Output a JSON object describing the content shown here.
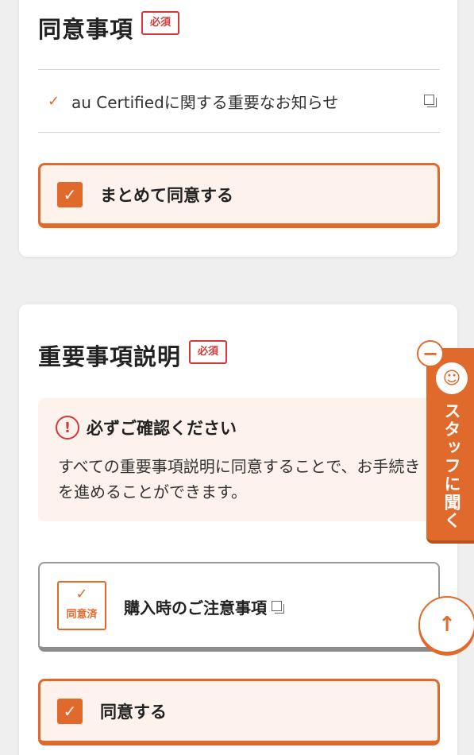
{
  "consent_section": {
    "title": "同意事項",
    "required_badge": "必須",
    "item_label": "au Certifiedに関する重要なお知らせ",
    "check_all_label": "まとめて同意する"
  },
  "important_section": {
    "title": "重要事項説明",
    "required_badge": "必須",
    "notice_title": "必ずご確認ください",
    "notice_body": "すべての重要事項説明に同意することで、お手続きを進めることができます。",
    "item": {
      "status_badge": "同意済",
      "title": "購入時のご注意事項"
    },
    "agree_label": "同意する"
  },
  "staff_tab": {
    "label": "スタッフに聞く"
  },
  "icons": {
    "check": "check-icon",
    "external": "external-link-icon",
    "warning": "warning-circle-icon",
    "minus": "minus-circle-icon",
    "headset": "headset-staff-icon",
    "arrow_up": "arrow-up-icon"
  },
  "colors": {
    "accent": "#e06a2c",
    "required": "#d23a3a",
    "notice_bg": "#fdf3ec"
  }
}
